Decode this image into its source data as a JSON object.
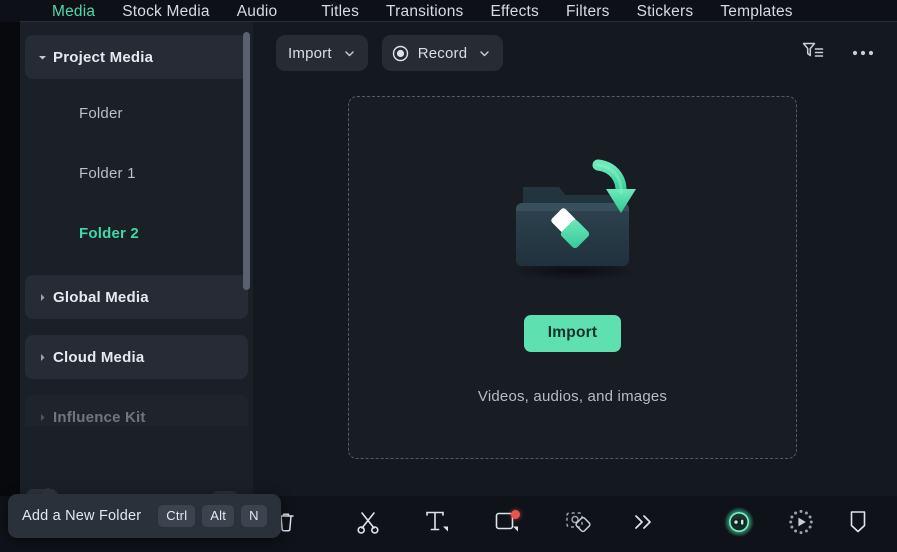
{
  "tabs": [
    {
      "label": "Media",
      "active": true
    },
    {
      "label": "Stock Media",
      "active": false
    },
    {
      "label": "Audio",
      "active": false
    },
    {
      "label": "Titles",
      "active": false
    },
    {
      "label": "Transitions",
      "active": false
    },
    {
      "label": "Effects",
      "active": false
    },
    {
      "label": "Filters",
      "active": false
    },
    {
      "label": "Stickers",
      "active": false
    },
    {
      "label": "Templates",
      "active": false
    }
  ],
  "sidebar": {
    "tree": [
      {
        "label": "Project Media",
        "type": "branch",
        "expanded": true,
        "selected": false,
        "faded": false
      },
      {
        "label": "Folder",
        "type": "child",
        "selected": false,
        "faded": false
      },
      {
        "label": "Folder 1",
        "type": "child",
        "selected": false,
        "faded": false
      },
      {
        "label": "Folder 2",
        "type": "child",
        "selected": true,
        "faded": false
      },
      {
        "label": "Global Media",
        "type": "branch",
        "expanded": false,
        "selected": false,
        "faded": false
      },
      {
        "label": "Cloud Media",
        "type": "branch",
        "expanded": false,
        "selected": false,
        "faded": false
      },
      {
        "label": "Influence Kit",
        "type": "branch",
        "expanded": false,
        "selected": false,
        "faded": true
      }
    ],
    "bottom_buttons": [
      {
        "name": "add-folder-icon",
        "title": "Add a New Folder"
      },
      {
        "name": "delete-folder-icon",
        "title": "Delete Folder"
      },
      {
        "name": "collapse-panel-icon",
        "title": "Collapse"
      }
    ]
  },
  "toolbar": {
    "import_label": "Import",
    "record_label": "Record",
    "filter_icon": "filter-sort-icon",
    "more_icon": "more-options-icon"
  },
  "dropzone": {
    "import_button_label": "Import",
    "subtitle": "Videos, audios, and images",
    "art_icon": "import-folder-illustration"
  },
  "bottom_toolbar": [
    {
      "name": "delete-icon",
      "badge": false
    },
    {
      "name": "split-scissors-icon",
      "badge": false
    },
    {
      "name": "text-tool-icon",
      "badge": false
    },
    {
      "name": "crop-tool-icon",
      "badge": true
    },
    {
      "name": "mask-shape-icon",
      "badge": false
    },
    {
      "name": "more-tools-chevron-icon",
      "badge": false
    },
    {
      "name": "ai-copilot-icon",
      "badge": false
    },
    {
      "name": "render-preview-icon",
      "badge": false
    },
    {
      "name": "marker-badge-icon",
      "badge": false
    },
    {
      "name": "voiceover-mic-icon",
      "badge": false
    }
  ],
  "tooltip": {
    "text": "Add a New Folder",
    "keys": [
      "Ctrl",
      "Alt",
      "N"
    ]
  },
  "colors": {
    "accent": "#3fd9a8",
    "accent_button": "#5fe0b0",
    "panel": "#1b1f27",
    "main": "#14181f",
    "badge_red": "#e9554d"
  }
}
